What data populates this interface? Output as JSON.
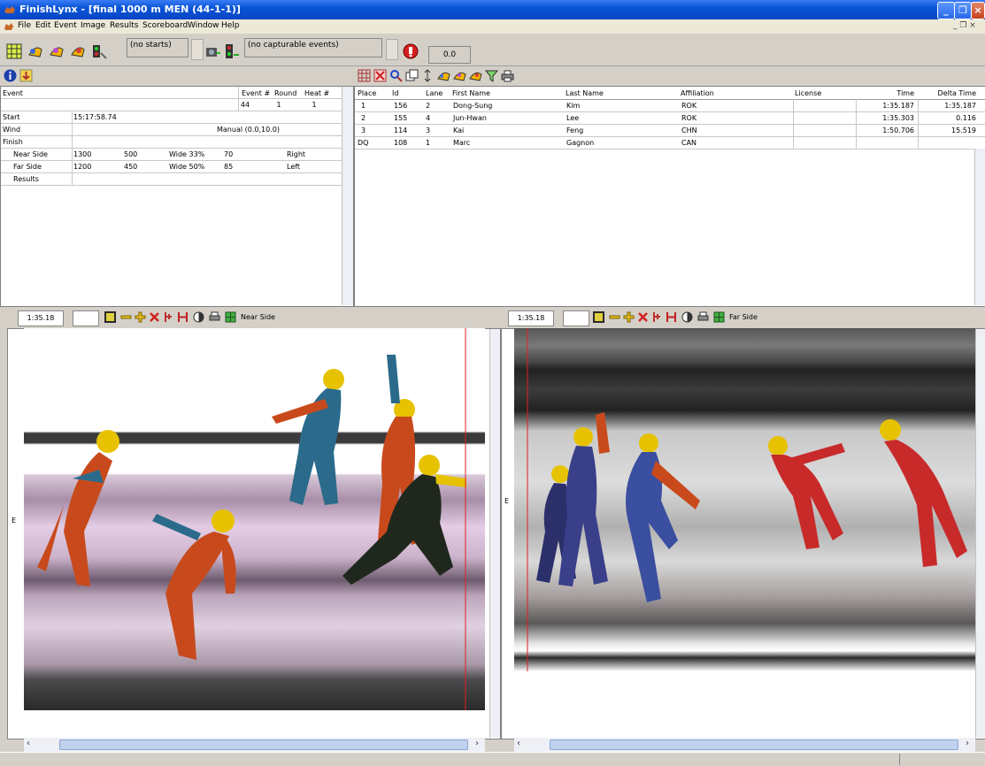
{
  "window": {
    "title": "FinishLynx - [final 1000 m MEN (44-1-1)]"
  },
  "menu": [
    "File",
    "Edit",
    "Event",
    "Image",
    "Results",
    "Scoreboard",
    "Window",
    "Help"
  ],
  "toolbar": {
    "starts_text": "(no starts)",
    "capture_text": "(no capturable events)",
    "time_value": "0.0"
  },
  "event_panel": {
    "headers": {
      "event": "Event",
      "event_no": "Event #",
      "round": "Round",
      "heat": "Heat #"
    },
    "values": {
      "event_no": "44",
      "round": "1",
      "heat": "1"
    },
    "start_label": "Start",
    "start_value": "15:17:58.74",
    "wind_label": "Wind",
    "wind_value": "Manual (0.0,10.0)",
    "finish_label": "Finish",
    "near": {
      "label": "Near Side",
      "a": "1300",
      "b": "500",
      "c": "Wide 33%",
      "d": "70",
      "e": "Right"
    },
    "far": {
      "label": "Far Side",
      "a": "1200",
      "b": "450",
      "c": "Wide 50%",
      "d": "85",
      "e": "Left"
    },
    "results_label": "Results"
  },
  "results": {
    "columns": [
      "Place",
      "Id",
      "Lane",
      "First Name",
      "Last Name",
      "Affiliation",
      "License",
      "Time",
      "Delta Time"
    ],
    "rows": [
      [
        "1",
        "156",
        "2",
        "Dong-Sung",
        "Kim",
        "ROK",
        "",
        "1:35.187",
        "1:35.187"
      ],
      [
        "2",
        "155",
        "4",
        "Jun-Hwan",
        "Lee",
        "ROK",
        "",
        "1:35.303",
        "0.116"
      ],
      [
        "3",
        "114",
        "3",
        "Kai",
        "Feng",
        "CHN",
        "",
        "1:50.706",
        "15.519"
      ],
      [
        "DQ",
        "108",
        "1",
        "Marc",
        "Gagnon",
        "CAN",
        "",
        "",
        ""
      ]
    ]
  },
  "near_image": {
    "time": "1:35.18",
    "label": "Near Side",
    "edge_mark": "E"
  },
  "far_image": {
    "time": "1:35.18",
    "label": "Far Side",
    "edge_mark": "E"
  },
  "colors": {
    "titlebar": "#0a54d6",
    "hairline": "#e02020",
    "panel_bg": "#d4d0c8"
  }
}
